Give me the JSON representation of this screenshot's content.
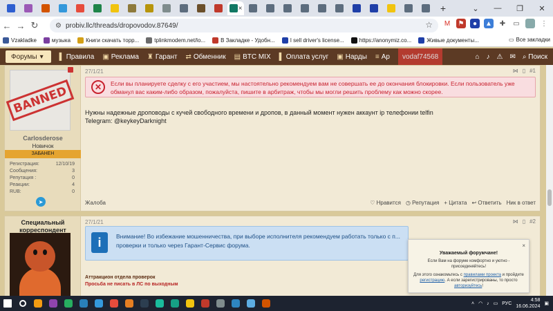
{
  "browser": {
    "tab_colors": [
      "#2f5fd0",
      "#9b59b6",
      "#d35400",
      "#3498db",
      "#e74c3c",
      "#1e8449",
      "#f1c40f",
      "#8e7a3b",
      "#b7950b",
      "#7f8c8d",
      "#5d6d7e",
      "#6b4f2a",
      "#c0392b",
      "#117864",
      "#5d6d7e",
      "#5d6d7e",
      "#5d6d7e",
      "#5d6d7e",
      "#5d6d7e",
      "#5d6d7e",
      "#1f3fa8",
      "#1f3fa8",
      "#f1c40f",
      "#5d6d7e",
      "#5d6d7e"
    ],
    "tab_close": "×",
    "new_tab": "+",
    "window_controls": [
      "⌄",
      "—",
      "❐",
      "✕"
    ],
    "url": "probiv.llc/threads/dropovodov.87649/",
    "bookmarks": [
      {
        "label": "Vzakladke",
        "color": "#3b5998"
      },
      {
        "label": "музыка",
        "color": "#7b3fa0"
      },
      {
        "label": "Книги скачать торр...",
        "color": "#d4a017"
      },
      {
        "label": "tplinkmodem.net/lo...",
        "color": "#6b6b6b"
      },
      {
        "label": "В Закладке - Удобн...",
        "color": "#c0392b"
      },
      {
        "label": "I sell driver's license...",
        "color": "#1f3fa8"
      },
      {
        "label": "https://anonymiz.co...",
        "color": "#111111"
      },
      {
        "label": "Живые документы...",
        "color": "#1f3fa8"
      }
    ],
    "all_bookmarks": "Все закладки"
  },
  "forum_nav": {
    "items": [
      {
        "label": "Форумы",
        "icon": "▾"
      },
      {
        "label": "Правила",
        "icon": "▌"
      },
      {
        "label": "Реклама",
        "icon": "▣"
      },
      {
        "label": "Гарант",
        "icon": "♜"
      },
      {
        "label": "Обменник",
        "icon": "⇄"
      },
      {
        "label": "BTC MIX",
        "icon": "▤"
      },
      {
        "label": "Оплата услуг",
        "icon": "▌"
      },
      {
        "label": "Нарды",
        "icon": "▣"
      },
      {
        "label": "Ар",
        "icon": "≡"
      }
    ],
    "user": "vodaf74568",
    "search": "Поиск"
  },
  "post1": {
    "date": "27/1/21",
    "number": "#1",
    "username": "Carlosderose",
    "rank": "Новичок",
    "badge": "ЗАБАНЕН",
    "stamp": "BANNED",
    "stats": [
      {
        "k": "Регистрация:",
        "v": "12/10/19"
      },
      {
        "k": "Сообщения:",
        "v": "3"
      },
      {
        "k": "Репутация :",
        "v": "0"
      },
      {
        "k": "Реакции:",
        "v": "4"
      },
      {
        "k": "RUB:",
        "v": "0"
      }
    ],
    "warning": "Если вы планируете сделку с его участием, мы настоятельно рекомендуем вам не совершать ее до окончания блокировки. Если пользователь уже обманул вас каким-либо образом, пожалуйста, пишите в арбитраж, чтобы мы могли решить проблему как можно скорее.",
    "text_line1": "Нужны надежные дроповоды с кучей свободного времени и дропов, в данный момент нужен аккаунт ip телефонии telfin",
    "text_line2": "Telegram: @keykeyDarknight",
    "report": "Жалоба",
    "actions": [
      "Нравится",
      "Репутация",
      "+ Цитата",
      "Ответить",
      "Ник в ответ"
    ]
  },
  "post2": {
    "date": "27/1/21",
    "number": "#2",
    "user_title": "Специальный корреспондент",
    "notice": "Внимание! Во избежание мошенничества, при выборе исполнителя рекомендуем работать только с п... проверки и только через Гарант-Сервис форума.",
    "attraction": "Аттракцион отдела проверок",
    "attraction2": "Просьба не писать в ЛС по выходным"
  },
  "popup": {
    "title": "Уважаемый форумчане!",
    "line1": "Если Вам на форуме комфортно и уютно - присоединяйтесь!",
    "line2_pre": "Для этого ознакомьтесь с ",
    "rules_link": "правилами проекта",
    "line2_mid": " и пройдите ",
    "reg_link": "регистрацию",
    "line2_post": ". А если зарегистрированы, то просто ",
    "auth_link": "авторизуйтесь",
    "line2_end": "!",
    "close": "×"
  },
  "taskbar": {
    "app_colors": [
      "#ffffff",
      "#ffffff",
      "#f39c12",
      "#8e44ad",
      "#27ae60",
      "#2980b9",
      "#3498db",
      "#e74c3c",
      "#e67e22",
      "#2c3e50",
      "#1abc9c",
      "#16a085",
      "#f1c40f",
      "#c0392b",
      "#7f8c8d",
      "#2e86c1",
      "#5dade2",
      "#d35400"
    ],
    "lang": "РУС",
    "time": "4:58",
    "date": "16.06.2024"
  }
}
